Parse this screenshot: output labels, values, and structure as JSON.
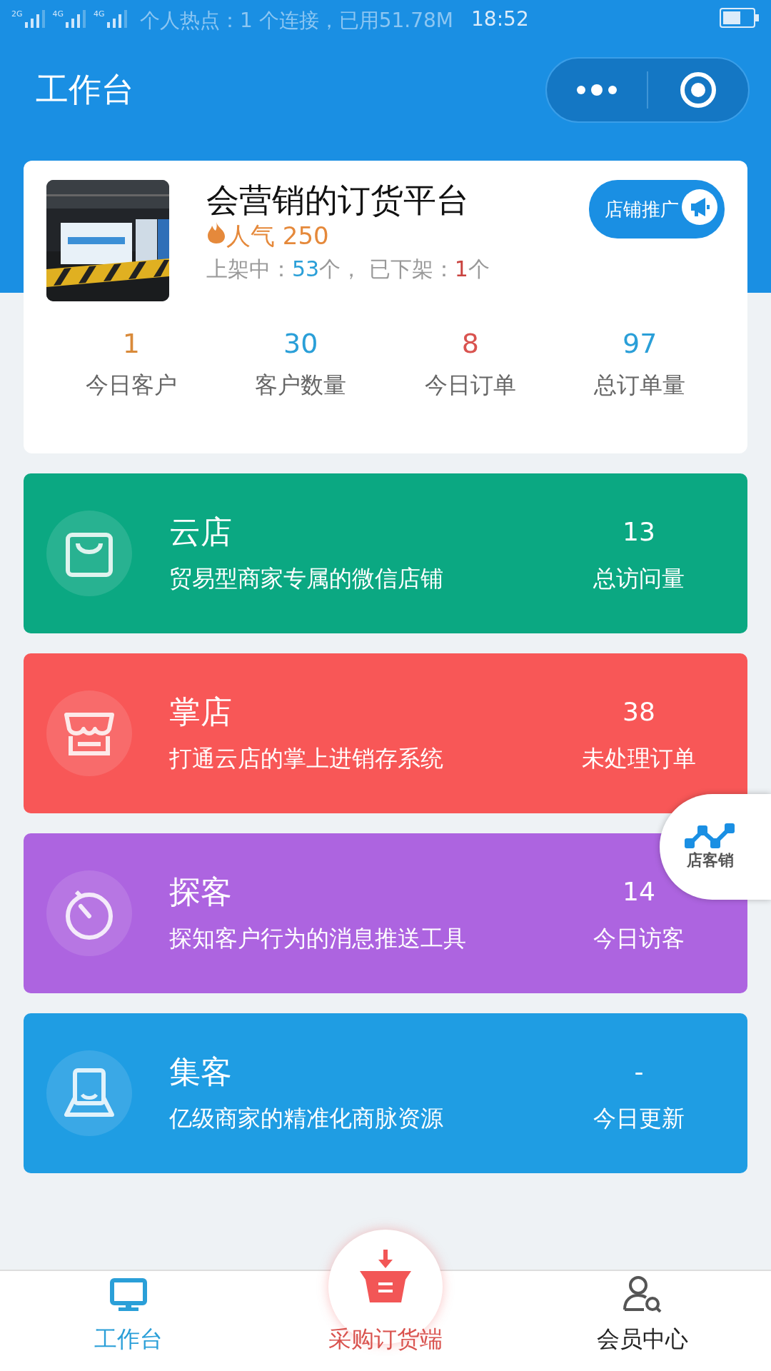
{
  "status_bar": {
    "signal_labels": [
      "2G",
      "4G",
      "4G"
    ],
    "hotspot": "个人热点：1 个连接，已用51.78M",
    "time": "18:52"
  },
  "header": {
    "title": "工作台"
  },
  "store": {
    "name": "会营销的订货平台",
    "popularity": "人气 250",
    "on_shelf_label": "上架中：",
    "on_shelf_count": "53",
    "unit_1": "个，",
    "off_shelf_label": "已下架：",
    "off_shelf_count": "1",
    "unit_2": "个",
    "promote_button": "店铺推广",
    "stats": [
      {
        "value": "1",
        "label": "今日客户",
        "color": "#d98a3a"
      },
      {
        "value": "30",
        "label": "客户数量",
        "color": "#2a9fd8"
      },
      {
        "value": "8",
        "label": "今日订单",
        "color": "#d9534f"
      },
      {
        "value": "97",
        "label": "总订单量",
        "color": "#2a9fd8"
      }
    ]
  },
  "features": [
    {
      "kind": "bag",
      "title": "云店",
      "description": "贸易型商家专属的微信店铺",
      "value": "13",
      "value_label": "总访问量",
      "color": "#0ba882"
    },
    {
      "kind": "store",
      "title": "掌店",
      "description": "打通云店的掌上进销存系统",
      "value": "38",
      "value_label": "未处理订单",
      "color": "#f85757"
    },
    {
      "kind": "timer",
      "title": "探客",
      "description": "探知客户行为的消息推送工具",
      "value": "14",
      "value_label": "今日访客",
      "color": "#ad64e0"
    },
    {
      "kind": "profile",
      "title": "集客",
      "description": "亿级商家的精准化商脉资源",
      "value": "-",
      "value_label": "今日更新",
      "color": "#1f9de3"
    }
  ],
  "floating_badge": {
    "label": "店客销"
  },
  "tabs": [
    {
      "kind": "normal",
      "label": "工作台",
      "selected": true
    },
    {
      "kind": "center",
      "label": "采购订货端",
      "selected": false
    },
    {
      "kind": "normal",
      "label": "会员中心",
      "selected": false
    }
  ]
}
